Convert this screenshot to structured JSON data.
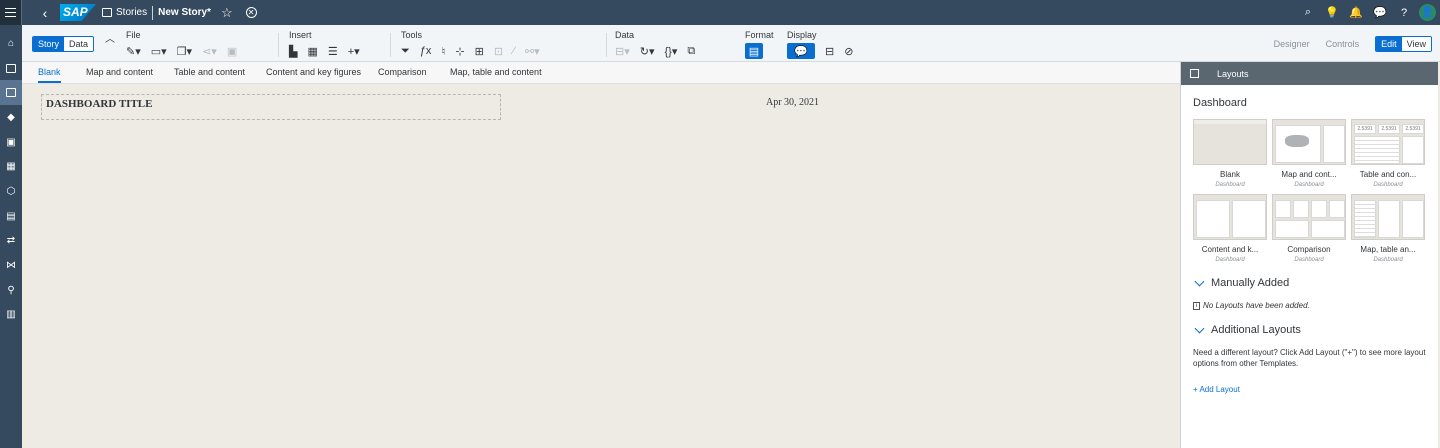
{
  "shell": {
    "logo": "SAP",
    "crumb": "Stories",
    "story_name": "New Story",
    "dirty_marker": "*"
  },
  "toolbar": {
    "mode_story": "Story",
    "mode_data": "Data",
    "groups": {
      "file": "File",
      "insert": "Insert",
      "tools": "Tools",
      "data": "Data",
      "format": "Format",
      "display": "Display"
    },
    "designer": "Designer",
    "controls": "Controls",
    "edit": "Edit",
    "view": "View"
  },
  "page_tabs": [
    "Blank",
    "Map and content",
    "Table and content",
    "Content and key figures",
    "Comparison",
    "Map, table and content"
  ],
  "canvas": {
    "title": "DASHBOARD TITLE",
    "date": "Apr 30, 2021"
  },
  "panel": {
    "header": "Layouts",
    "dashboard_title": "Dashboard",
    "cards": [
      {
        "name": "Blank",
        "sub": "Dashboard"
      },
      {
        "name": "Map and cont...",
        "sub": "Dashboard"
      },
      {
        "name": "Table and con...",
        "sub": "Dashboard"
      },
      {
        "name": "Content and k...",
        "sub": "Dashboard"
      },
      {
        "name": "Comparison",
        "sub": "Dashboard"
      },
      {
        "name": "Map, table an...",
        "sub": "Dashboard"
      }
    ],
    "manually_added": "Manually Added",
    "no_layouts": "No Layouts have been added.",
    "additional": "Additional Layouts",
    "additional_text": "Need a different layout? Click Add Layout (\"+\") to see more layout options from other Templates.",
    "add_link": "+ Add Layout",
    "kpi_value": "2.5391"
  },
  "colors": {
    "shell": "#354a5f",
    "accent": "#0a6ed1",
    "canvas": "#edebe4"
  }
}
